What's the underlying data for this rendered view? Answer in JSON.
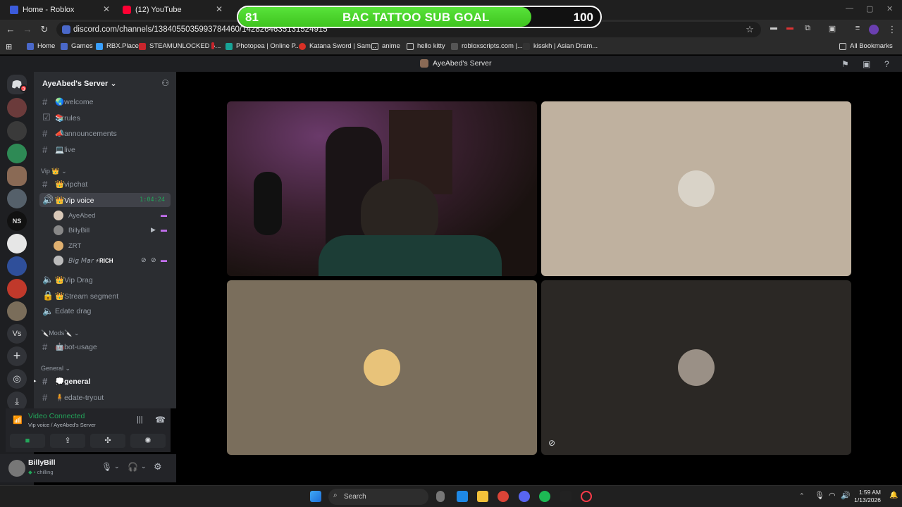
{
  "browser": {
    "tabs": [
      {
        "title": "Home - Roblox",
        "color": "#3b5bdb"
      },
      {
        "title": "(12) YouTube",
        "color": "#ff0033"
      }
    ],
    "url": "discord.com/channels/1384055035993784460/1428264635131524915",
    "bookmarks": [
      {
        "label": "Home",
        "color": "#4a68c9"
      },
      {
        "label": "Games",
        "color": "#4a68c9"
      },
      {
        "label": "RBX.Place",
        "color": "#3aa0ff"
      },
      {
        "label": "STEAMUNLOCKED »...",
        "color": "#c8252c"
      },
      {
        "label": "",
        "color": "#c8252c"
      },
      {
        "label": "Photopea | Online P...",
        "color": "#18a497"
      },
      {
        "label": "Katana Sword | Sam...",
        "color": "#d93025"
      },
      {
        "label": "anime",
        "color": "folder"
      },
      {
        "label": "hello kitty",
        "color": "folder"
      },
      {
        "label": "robloxscripts.com |...",
        "color": "#555"
      },
      {
        "label": "kisskh | Asian Dram...",
        "color": "#333"
      }
    ],
    "all_bookmarks": "All Bookmarks"
  },
  "subgoal": {
    "current": "81",
    "target": "100",
    "title": "BAC TATTOO SUB GOAL",
    "progress": 0.81
  },
  "discord": {
    "header_server": "AyeAbed's Server",
    "server_name": "AyeAbed's Server",
    "rail_badge": "3",
    "rail_text_ns": "NS",
    "rail_text_vs": "Vs",
    "channels": {
      "welcome": "🌏welcome",
      "rules": "📚rules",
      "announcements": "📣announcements",
      "live": "💻live",
      "cat_vip": "Vip 👑",
      "vipchat": "👑vipchat",
      "vip_voice": "👑Vip voice",
      "vip_voice_timer": "1:04:24",
      "members": [
        {
          "name": "AyeAbed"
        },
        {
          "name": "BillyBill"
        },
        {
          "name": "ZRT"
        },
        {
          "name": "𝘉𝘪𝘨 𝘔𝘢𝘳",
          "tag": "⚡RICH"
        }
      ],
      "vip_drag": "👑Vip Drag",
      "stream_segment": "👑Stream segment",
      "edate_drag": "Edate drag",
      "cat_mods": "🔪Mods🔪",
      "bot_usage": "🤖bot-usage",
      "cat_general": "General",
      "general": "💭general",
      "edate_tryout": "🧍edate-tryout"
    },
    "voice": {
      "status": "Video Connected",
      "location": "Vip voice / AyeAbed's Server"
    },
    "user": {
      "name": "BillyBill",
      "status": "chilling"
    }
  },
  "taskbar": {
    "search": "Search",
    "time": "1:59 AM",
    "date": "1/13/2026"
  }
}
